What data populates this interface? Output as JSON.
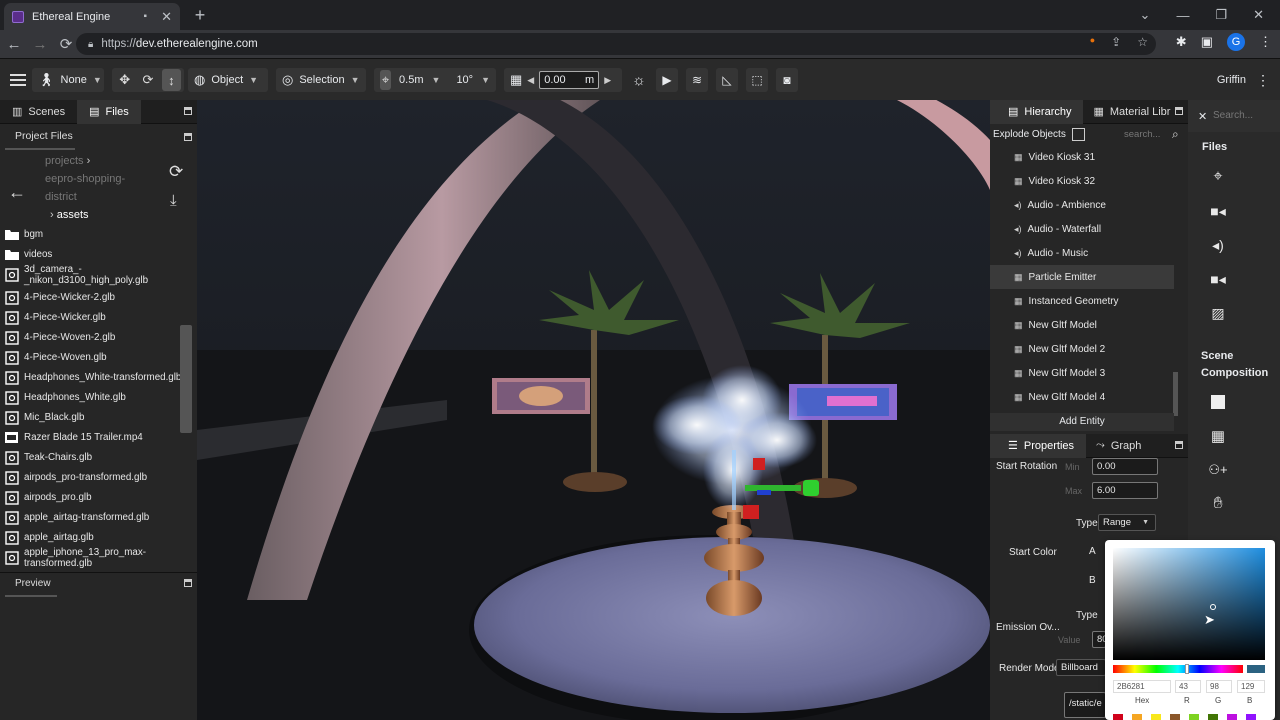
{
  "browser": {
    "tab_title": "Ethereal Engine",
    "url_prefix": "https://",
    "url_host": "dev.etherealengine.com",
    "avatar_letter": "G"
  },
  "toolbar": {
    "locomotion": "None",
    "transform_space": "Object",
    "pivot": "Selection",
    "translate_snap": "0.5m",
    "rotate_snap": "10°",
    "grid_height": "0.00",
    "grid_unit": "m",
    "user_name": "Griffin"
  },
  "left_panel": {
    "tabs": [
      "Scenes",
      "Files"
    ],
    "project_files_label": "Project Files",
    "breadcrumbs": [
      "projects",
      "eepro-shopping-",
      "district"
    ],
    "current_folder": "assets",
    "files": [
      {
        "name": "bgm",
        "icon": "folder-icon"
      },
      {
        "name": "videos",
        "icon": "folder-icon"
      },
      {
        "name": "3d_camera_-\n_nikon_d3100_high_poly.glb",
        "icon": "model-icon"
      },
      {
        "name": "4-Piece-Wicker-2.glb",
        "icon": "model-icon"
      },
      {
        "name": "4-Piece-Wicker.glb",
        "icon": "model-icon"
      },
      {
        "name": "4-Piece-Woven-2.glb",
        "icon": "model-icon"
      },
      {
        "name": "4-Piece-Woven.glb",
        "icon": "model-icon"
      },
      {
        "name": "Headphones_White-transformed.glb",
        "icon": "model-icon"
      },
      {
        "name": "Headphones_White.glb",
        "icon": "model-icon"
      },
      {
        "name": "Mic_Black.glb",
        "icon": "model-icon"
      },
      {
        "name": "Razer Blade 15 Trailer.mp4",
        "icon": "video-file-icon"
      },
      {
        "name": "Teak-Chairs.glb",
        "icon": "model-icon"
      },
      {
        "name": "airpods_pro-transformed.glb",
        "icon": "model-icon"
      },
      {
        "name": "airpods_pro.glb",
        "icon": "model-icon"
      },
      {
        "name": "apple_airtag-transformed.glb",
        "icon": "model-icon"
      },
      {
        "name": "apple_airtag.glb",
        "icon": "model-icon"
      },
      {
        "name": "apple_iphone_13_pro_max-\ntransformed.glb",
        "icon": "model-icon"
      }
    ],
    "preview_label": "Preview"
  },
  "hierarchy": {
    "tabs": [
      "Hierarchy",
      "Material Libr"
    ],
    "explode_label": "Explode Objects",
    "search_placeholder": "search...",
    "items": [
      {
        "name": "Video Kiosk 31",
        "icon": "grid-icon"
      },
      {
        "name": "Video Kiosk 32",
        "icon": "grid-icon"
      },
      {
        "name": "Audio - Ambience",
        "icon": "speaker-icon"
      },
      {
        "name": "Audio - Waterfall",
        "icon": "speaker-icon"
      },
      {
        "name": "Audio - Music",
        "icon": "speaker-icon"
      },
      {
        "name": "Particle Emitter",
        "icon": "grid-icon",
        "selected": true
      },
      {
        "name": "Instanced Geometry",
        "icon": "grid-icon"
      },
      {
        "name": "New Gltf Model",
        "icon": "grid-icon"
      },
      {
        "name": "New Gltf Model 2",
        "icon": "grid-icon"
      },
      {
        "name": "New Gltf Model 3",
        "icon": "grid-icon"
      },
      {
        "name": "New Gltf Model 4",
        "icon": "grid-icon"
      }
    ],
    "add_entity": "Add Entity"
  },
  "properties": {
    "tabs": [
      "Properties",
      "Graph"
    ],
    "start_rotation": "Start Rotation",
    "min_label": "Min",
    "min_value": "0.00",
    "max_label": "Max",
    "max_value": "6.00",
    "type_label": "Type",
    "type_value": "Range",
    "start_color": "Start Color",
    "a_label": "A",
    "b_label": "B",
    "type2_label": "Type",
    "emission": "Emission Ov...",
    "value_label": "Value",
    "value_val": "80",
    "render_mode": "Render Mode",
    "render_mode_value": "Billboard",
    "texture_path": "/static/e"
  },
  "side_column": {
    "search_placeholder": "Search...",
    "files_heading": "Files",
    "scene_heading_1": "Scene",
    "scene_heading_2": "Composition"
  },
  "color_picker": {
    "hex": "2B6281",
    "r": "43",
    "g": "98",
    "b": "129",
    "hex_label": "Hex",
    "r_label": "R",
    "g_label": "G",
    "b_label": "B",
    "hue_color": "#1e8ee0",
    "selected_color": "#2b6281"
  }
}
